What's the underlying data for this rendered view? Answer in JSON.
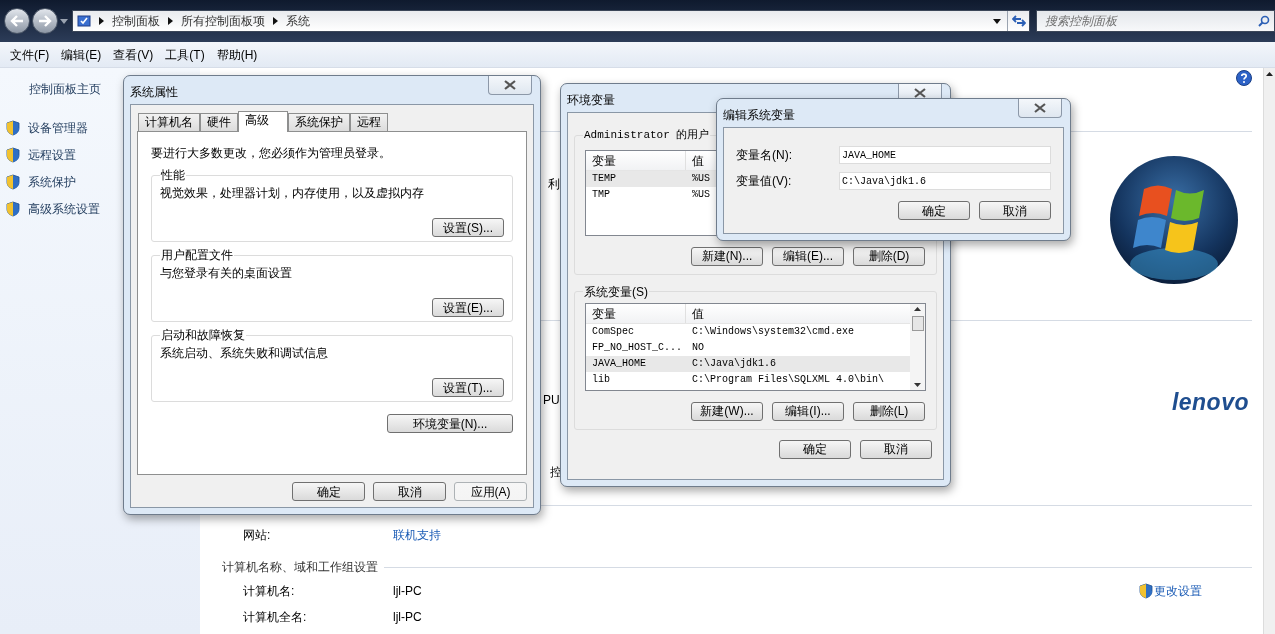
{
  "explorer": {
    "breadcrumb": [
      "控制面板",
      "所有控制面板项",
      "系统"
    ],
    "search_placeholder": "搜索控制面板"
  },
  "menu": [
    "文件(F)",
    "编辑(E)",
    "查看(V)",
    "工具(T)",
    "帮助(H)"
  ],
  "sidebar": {
    "home": "控制面板主页",
    "items": [
      "设备管理器",
      "远程设置",
      "系统保护",
      "高级系统设置"
    ]
  },
  "content": {
    "fragments": [
      "利",
      "PU",
      "控"
    ],
    "oem_logo": "lenovo",
    "website_label": "网站:",
    "website_link": "联机支持",
    "section_title": "计算机名称、域和工作组设置",
    "rows": [
      {
        "label": "计算机名:",
        "value": "ljl-PC"
      },
      {
        "label": "计算机全名:",
        "value": "ljl-PC"
      }
    ],
    "change_settings": "更改设置"
  },
  "system_properties": {
    "title": "系统属性",
    "tabs": [
      {
        "label": "计算机名",
        "selected": false
      },
      {
        "label": "硬件",
        "selected": false
      },
      {
        "label": "高级",
        "selected": true
      },
      {
        "label": "系统保护",
        "selected": false
      },
      {
        "label": "远程",
        "selected": false
      }
    ],
    "note": "要进行大多数更改，您必须作为管理员登录。",
    "groups": [
      {
        "title": "性能",
        "description": "视觉效果，处理器计划，内存使用，以及虚拟内存",
        "button": "设置(S)..."
      },
      {
        "title": "用户配置文件",
        "description": "与您登录有关的桌面设置",
        "button": "设置(E)..."
      },
      {
        "title": "启动和故障恢复",
        "description": "系统启动、系统失败和调试信息",
        "button": "设置(T)..."
      }
    ],
    "env_button": "环境变量(N)...",
    "buttons": [
      {
        "label": "确定",
        "disabled": false
      },
      {
        "label": "取消",
        "disabled": false
      },
      {
        "label": "应用(A)",
        "disabled": true
      }
    ]
  },
  "environment_variables": {
    "title": "环境变量",
    "user_group": {
      "title": "Administrator 的用户",
      "columns": [
        "变量",
        "值"
      ],
      "rows": [
        {
          "name": "TEMP",
          "value": "%US",
          "selected": true
        },
        {
          "name": "TMP",
          "value": "%US",
          "selected": false
        }
      ],
      "buttons": [
        "新建(N)...",
        "编辑(E)...",
        "删除(D)"
      ]
    },
    "system_group": {
      "title": "系统变量(S)",
      "columns": [
        "变量",
        "值"
      ],
      "rows": [
        {
          "name": "ComSpec",
          "value": "C:\\Windows\\system32\\cmd.exe",
          "selected": false
        },
        {
          "name": "FP_NO_HOST_C...",
          "value": "NO",
          "selected": false
        },
        {
          "name": "JAVA_HOME",
          "value": "C:\\Java\\jdk1.6",
          "selected": true
        },
        {
          "name": "lib",
          "value": "C:\\Program Files\\SQLXML 4.0\\bin\\",
          "selected": false
        }
      ],
      "buttons": [
        "新建(W)...",
        "编辑(I)...",
        "删除(L)"
      ]
    },
    "buttons": [
      "确定",
      "取消"
    ]
  },
  "edit_variable": {
    "title": "编辑系统变量",
    "fields": [
      {
        "label": "变量名(N):",
        "value": "JAVA_HOME"
      },
      {
        "label": "变量值(V):",
        "value": "C:\\Java\\jdk1.6"
      }
    ],
    "buttons": [
      "确定",
      "取消"
    ]
  }
}
